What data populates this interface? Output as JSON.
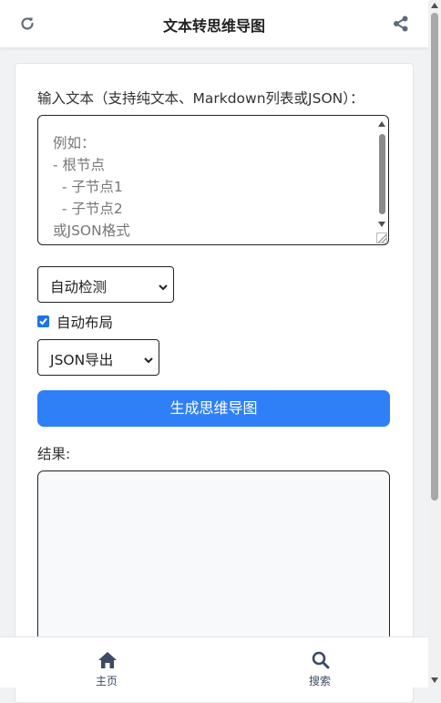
{
  "header": {
    "title": "文本转思维导图",
    "left_icon": "refresh-icon",
    "right_icon": "share-icon"
  },
  "form": {
    "input_label": "输入文本（支持纯文本、Markdown列表或JSON）：",
    "textarea_placeholder": "例如：\n- 根节点\n  - 子节点1\n  - 子节点2\n或JSON格式",
    "mode_select": {
      "value": "自动检测"
    },
    "auto_layout": {
      "label": "自动布局",
      "checked": true
    },
    "export_select": {
      "value": "JSON导出"
    },
    "generate_button": "生成思维导图",
    "result_label": "结果:"
  },
  "bottom_nav": {
    "items": [
      {
        "label": "主页",
        "icon": "home-icon"
      },
      {
        "label": "搜索",
        "icon": "search-icon"
      }
    ]
  },
  "colors": {
    "accent": "#2f80f6",
    "nav_icon": "#3d4a63",
    "checkbox": "#1a73e8"
  }
}
